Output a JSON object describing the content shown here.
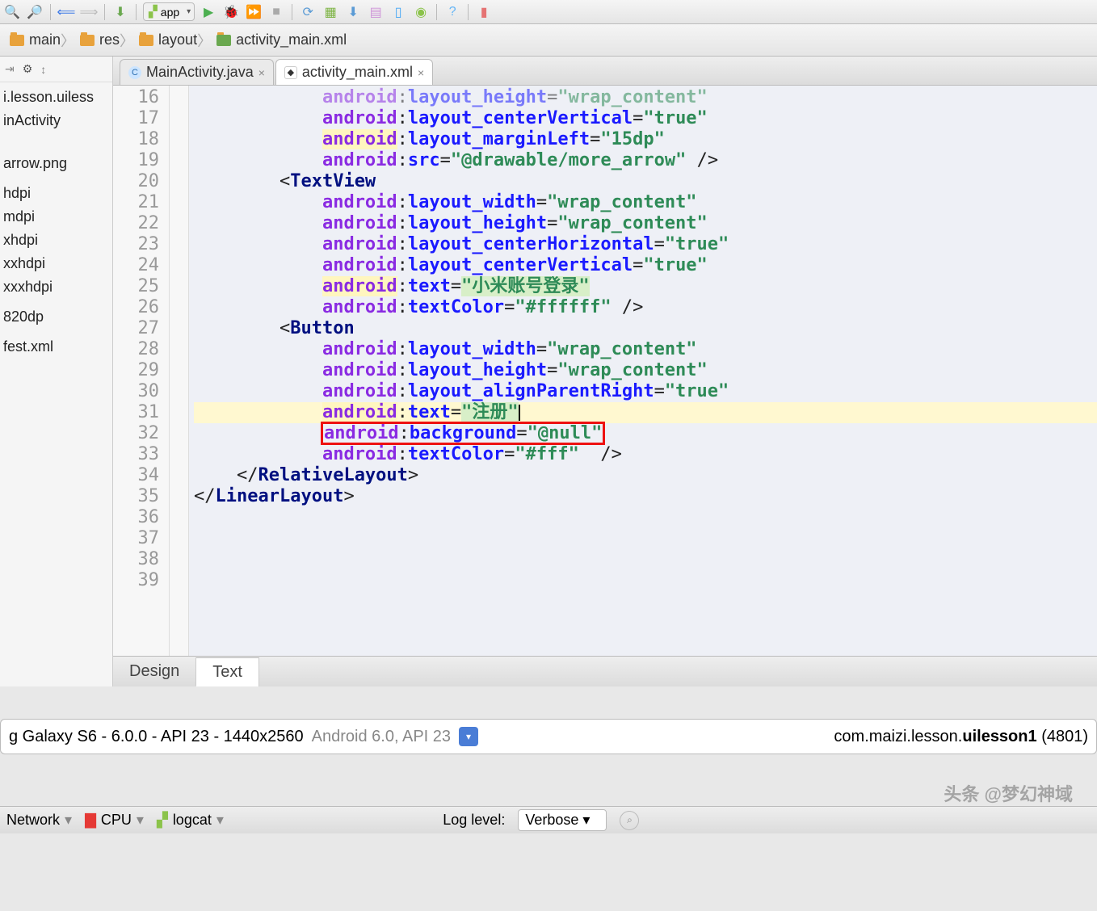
{
  "toolbar": {
    "app_label": "app"
  },
  "breadcrumb": {
    "items": [
      "main",
      "res",
      "layout",
      "activity_main.xml"
    ]
  },
  "tabs": [
    {
      "label": "MainActivity.java",
      "active": false,
      "icon": "java"
    },
    {
      "label": "activity_main.xml",
      "active": true,
      "icon": "xml"
    }
  ],
  "project": {
    "items": [
      "i.lesson.uiless",
      "inActivity",
      "",
      "",
      "",
      "arrow.png",
      "",
      "hdpi",
      "mdpi",
      "xhdpi",
      "xxhdpi",
      "xxxhdpi",
      "",
      "820dp",
      "",
      "fest.xml"
    ]
  },
  "editor": {
    "first_line_no": 16,
    "lines": [
      {
        "n": 16,
        "indent": 3,
        "raw": "android:layout_height=\"wrap_content\"",
        "parts": [
          [
            "ns",
            "android"
          ],
          [
            "p",
            ":"
          ],
          [
            "attr",
            "layout_height"
          ],
          [
            "p",
            "="
          ],
          [
            "str",
            "\"wrap_content\""
          ]
        ],
        "faded": true
      },
      {
        "n": 17,
        "indent": 3,
        "parts": [
          [
            "ns",
            "android"
          ],
          [
            "p",
            ":"
          ],
          [
            "attr",
            "layout_centerVertical"
          ],
          [
            "p",
            "="
          ],
          [
            "str",
            "\"true\""
          ]
        ]
      },
      {
        "n": 18,
        "indent": 3,
        "parts": [
          [
            "hlns",
            "android"
          ],
          [
            "p",
            ":"
          ],
          [
            "attr",
            "layout_marginLeft"
          ],
          [
            "p",
            "="
          ],
          [
            "str",
            "\"15dp\""
          ]
        ]
      },
      {
        "n": 19,
        "indent": 3,
        "parts": [
          [
            "ns",
            "android"
          ],
          [
            "p",
            ":"
          ],
          [
            "attr",
            "src"
          ],
          [
            "p",
            "="
          ],
          [
            "str",
            "\"@drawable/more_arrow\""
          ],
          [
            "p",
            " />"
          ]
        ]
      },
      {
        "n": 20,
        "indent": 0,
        "parts": []
      },
      {
        "n": 21,
        "indent": 2,
        "parts": [
          [
            "p",
            "<"
          ],
          [
            "tag",
            "TextView"
          ]
        ]
      },
      {
        "n": 22,
        "indent": 3,
        "parts": [
          [
            "ns",
            "android"
          ],
          [
            "p",
            ":"
          ],
          [
            "attr",
            "layout_width"
          ],
          [
            "p",
            "="
          ],
          [
            "str",
            "\"wrap_content\""
          ]
        ]
      },
      {
        "n": 23,
        "indent": 3,
        "parts": [
          [
            "ns",
            "android"
          ],
          [
            "p",
            ":"
          ],
          [
            "attr",
            "layout_height"
          ],
          [
            "p",
            "="
          ],
          [
            "str",
            "\"wrap_content\""
          ]
        ]
      },
      {
        "n": 24,
        "indent": 3,
        "parts": [
          [
            "ns",
            "android"
          ],
          [
            "p",
            ":"
          ],
          [
            "attr",
            "layout_centerHorizontal"
          ],
          [
            "p",
            "="
          ],
          [
            "str",
            "\"true\""
          ]
        ]
      },
      {
        "n": 25,
        "indent": 3,
        "parts": [
          [
            "ns",
            "android"
          ],
          [
            "p",
            ":"
          ],
          [
            "attr",
            "layout_centerVertical"
          ],
          [
            "p",
            "="
          ],
          [
            "str",
            "\"true\""
          ]
        ]
      },
      {
        "n": 26,
        "indent": 3,
        "parts": [
          [
            "hlns",
            "android"
          ],
          [
            "p",
            ":"
          ],
          [
            "attr",
            "text"
          ],
          [
            "p",
            "="
          ],
          [
            "strb",
            "\"小米账号登录\""
          ]
        ]
      },
      {
        "n": 27,
        "indent": 3,
        "parts": [
          [
            "ns",
            "android"
          ],
          [
            "p",
            ":"
          ],
          [
            "attr",
            "textColor"
          ],
          [
            "p",
            "="
          ],
          [
            "str",
            "\"#ffffff\""
          ],
          [
            "p",
            " />"
          ]
        ]
      },
      {
        "n": 28,
        "indent": 0,
        "parts": []
      },
      {
        "n": 29,
        "indent": 2,
        "parts": [
          [
            "p",
            "<"
          ],
          [
            "tag",
            "Button"
          ]
        ]
      },
      {
        "n": 30,
        "indent": 3,
        "parts": [
          [
            "ns",
            "android"
          ],
          [
            "p",
            ":"
          ],
          [
            "attr",
            "layout_width"
          ],
          [
            "p",
            "="
          ],
          [
            "str",
            "\"wrap_content\""
          ]
        ]
      },
      {
        "n": 31,
        "indent": 3,
        "parts": [
          [
            "ns",
            "android"
          ],
          [
            "p",
            ":"
          ],
          [
            "attr",
            "layout_height"
          ],
          [
            "p",
            "="
          ],
          [
            "str",
            "\"wrap_content\""
          ]
        ]
      },
      {
        "n": 32,
        "indent": 3,
        "parts": [
          [
            "ns",
            "android"
          ],
          [
            "p",
            ":"
          ],
          [
            "attr",
            "layout_alignParentRight"
          ],
          [
            "p",
            "="
          ],
          [
            "str",
            "\"true\""
          ]
        ]
      },
      {
        "n": 33,
        "indent": 3,
        "cursor": true,
        "parts": [
          [
            "hlns",
            "android"
          ],
          [
            "p",
            ":"
          ],
          [
            "attr",
            "text"
          ],
          [
            "p",
            "="
          ],
          [
            "strb",
            "\"注册\""
          ]
        ]
      },
      {
        "n": 34,
        "indent": 3,
        "box": true,
        "parts": [
          [
            "ns",
            "android"
          ],
          [
            "p",
            ":"
          ],
          [
            "attr",
            "background"
          ],
          [
            "p",
            "="
          ],
          [
            "str",
            "\"@null\""
          ]
        ]
      },
      {
        "n": 35,
        "indent": 3,
        "parts": [
          [
            "ns",
            "android"
          ],
          [
            "p",
            ":"
          ],
          [
            "attr",
            "textColor"
          ],
          [
            "p",
            "="
          ],
          [
            "str",
            "\"#fff\""
          ],
          [
            "p",
            "  />"
          ]
        ]
      },
      {
        "n": 36,
        "indent": 0,
        "parts": []
      },
      {
        "n": 37,
        "indent": 1,
        "parts": [
          [
            "p",
            "</"
          ],
          [
            "tag",
            "RelativeLayout"
          ],
          [
            "p",
            ">"
          ]
        ]
      },
      {
        "n": 38,
        "indent": 0,
        "parts": [
          [
            "p",
            "</"
          ],
          [
            "tag",
            "LinearLayout"
          ],
          [
            "p",
            ">"
          ]
        ]
      },
      {
        "n": 39,
        "indent": 0,
        "parts": []
      }
    ]
  },
  "bottom_tabs": {
    "design": "Design",
    "text": "Text",
    "active": "Text"
  },
  "device_bar": {
    "device": "g Galaxy S6 - 6.0.0 - API 23 - 1440x2560",
    "sub": "Android 6.0, API 23",
    "process": "com.maizi.lesson.",
    "process_bold": "uilesson1",
    "pid": "(4801)"
  },
  "footer": {
    "items": [
      "Network",
      "CPU",
      "logcat"
    ],
    "loglabel": "Log level:",
    "loglevel": "Verbose"
  },
  "watermark": "头条 @梦幻神域"
}
